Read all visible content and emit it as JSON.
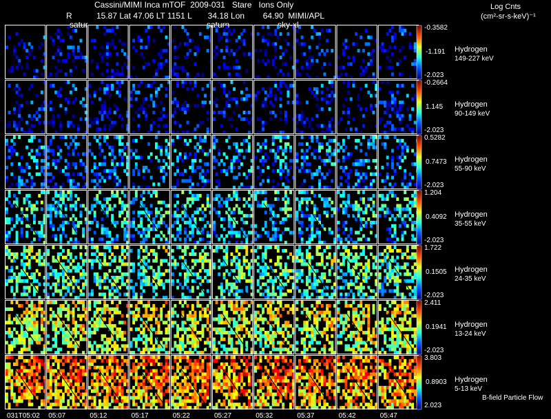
{
  "header": {
    "line1": "Cassini/MIMI Inca mTOF  2009-031   Stare   Ions Only",
    "line2_r": "R",
    "line2_rest": "15.87 Lat 47.06 LT 1151 L       34.18 Lon        64.90  MIMI/APL",
    "units_1": "Log Cnts",
    "units_2": "(cm²-sr-s-keV)⁻¹",
    "overlay_labels": [
      "satur",
      "saturn",
      "sky-xl"
    ]
  },
  "footer": {
    "legend": "B-field Particle Flow"
  },
  "chart_data": {
    "type": "heatmap",
    "times": [
      "031T05:02",
      "05:07",
      "05:12",
      "05:17",
      "05:22",
      "05:27",
      "05:32",
      "05:37",
      "05:42",
      "05:47"
    ],
    "channels": [
      {
        "species": "Hydrogen",
        "energy": "149-227 keV",
        "max": "-0.3582",
        "mid": "-1.191",
        "min": "-2.023",
        "level": 0.1
      },
      {
        "species": "Hydrogen",
        "energy": "90-149 keV",
        "max": "-0.2664",
        "mid": "1.145",
        "min": "-2.023",
        "level": 0.12
      },
      {
        "species": "Hydrogen",
        "energy": "55-90 keV",
        "max": "0.5282",
        "mid": "0.7473",
        "min": "-2.023",
        "level": 0.25
      },
      {
        "species": "Hydrogen",
        "energy": "35-55 keV",
        "max": "1.204",
        "mid": "0.4092",
        "min": "-2.023",
        "level": 0.35
      },
      {
        "species": "Hydrogen",
        "energy": "24-35 keV",
        "max": "1.722",
        "mid": "0.1505",
        "min": "-2.023",
        "level": 0.45
      },
      {
        "species": "Hydrogen",
        "energy": "13-24 keV",
        "max": "2.411",
        "mid": "0.1941",
        "min": "-2.023",
        "level": 0.58
      },
      {
        "species": "Hydrogen",
        "energy": "5-13 keV",
        "max": "3.803",
        "mid": "0.8903",
        "min": "2.023",
        "level": 0.72
      }
    ]
  }
}
